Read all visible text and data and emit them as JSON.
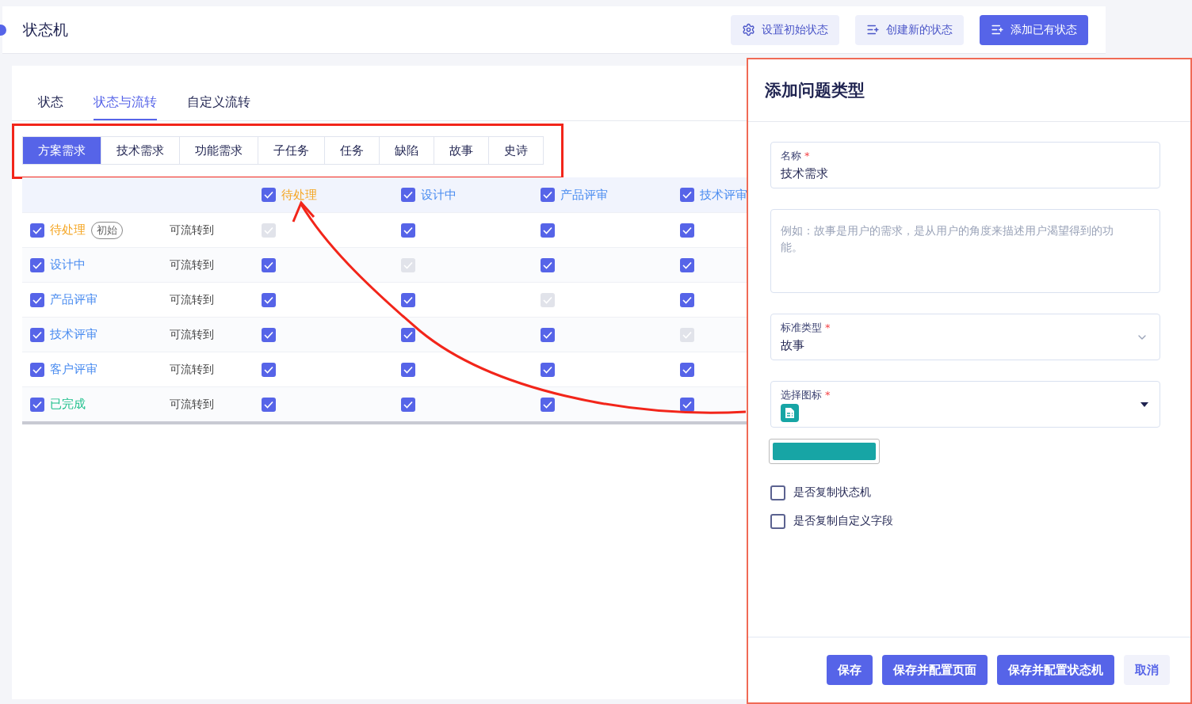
{
  "header": {
    "title": "状态机",
    "actions": [
      {
        "label": "设置初始状态",
        "kind": "settings",
        "primary": false
      },
      {
        "label": "创建新的状态",
        "kind": "add-list",
        "primary": false
      },
      {
        "label": "添加已有状态",
        "kind": "add-list",
        "primary": true
      }
    ]
  },
  "tabs": [
    {
      "label": "状态",
      "selected": false
    },
    {
      "label": "状态与流转",
      "selected": true
    },
    {
      "label": "自定义流转",
      "selected": false
    }
  ],
  "issue_types": [
    {
      "label": "方案需求",
      "selected": true
    },
    {
      "label": "技术需求",
      "selected": false
    },
    {
      "label": "功能需求",
      "selected": false
    },
    {
      "label": "子任务",
      "selected": false
    },
    {
      "label": "任务",
      "selected": false
    },
    {
      "label": "缺陷",
      "selected": false
    },
    {
      "label": "故事",
      "selected": false
    },
    {
      "label": "史诗",
      "selected": false
    }
  ],
  "matrix": {
    "columns": [
      {
        "label": "待处理",
        "color": "#f5a623",
        "checked": true
      },
      {
        "label": "设计中",
        "color": "#4a8cf0",
        "checked": true
      },
      {
        "label": "产品评审",
        "color": "#4a8cf0",
        "checked": true
      },
      {
        "label": "技术评审",
        "color": "#4a8cf0",
        "checked": true
      }
    ],
    "rows": [
      {
        "label": "待处理",
        "color": "#f5a623",
        "checked": true,
        "badge": "初始",
        "transition": "可流转到",
        "cells": [
          {
            "checked": true,
            "disabled": true
          },
          {
            "checked": true,
            "disabled": false
          },
          {
            "checked": true,
            "disabled": false
          },
          {
            "checked": true,
            "disabled": false
          }
        ]
      },
      {
        "label": "设计中",
        "color": "#4a8cf0",
        "checked": true,
        "transition": "可流转到",
        "cells": [
          {
            "checked": true,
            "disabled": false
          },
          {
            "checked": true,
            "disabled": true
          },
          {
            "checked": true,
            "disabled": false
          },
          {
            "checked": true,
            "disabled": false
          }
        ]
      },
      {
        "label": "产品评审",
        "color": "#4a8cf0",
        "checked": true,
        "transition": "可流转到",
        "cells": [
          {
            "checked": true,
            "disabled": false
          },
          {
            "checked": true,
            "disabled": false
          },
          {
            "checked": true,
            "disabled": true
          },
          {
            "checked": true,
            "disabled": false
          }
        ]
      },
      {
        "label": "技术评审",
        "color": "#4a8cf0",
        "checked": true,
        "transition": "可流转到",
        "cells": [
          {
            "checked": true,
            "disabled": false
          },
          {
            "checked": true,
            "disabled": false
          },
          {
            "checked": true,
            "disabled": false
          },
          {
            "checked": true,
            "disabled": true
          }
        ]
      },
      {
        "label": "客户评审",
        "color": "#4a8cf0",
        "checked": true,
        "transition": "可流转到",
        "cells": [
          {
            "checked": true,
            "disabled": false
          },
          {
            "checked": true,
            "disabled": false
          },
          {
            "checked": true,
            "disabled": false
          },
          {
            "checked": true,
            "disabled": false
          }
        ]
      },
      {
        "label": "已完成",
        "color": "#1bbf8a",
        "checked": true,
        "transition": "可流转到",
        "cells": [
          {
            "checked": true,
            "disabled": false
          },
          {
            "checked": true,
            "disabled": false
          },
          {
            "checked": true,
            "disabled": false
          },
          {
            "checked": true,
            "disabled": false
          }
        ]
      }
    ]
  },
  "drawer": {
    "title": "添加问题类型",
    "name_field": {
      "label": "名称",
      "required_mark": "*",
      "value": "技术需求"
    },
    "description": {
      "placeholder": "例如：故事是用户的需求，是从用户的角度来描述用户渴望得到的功能。"
    },
    "standard_type": {
      "label": "标准类型",
      "required_mark": "*",
      "value": "故事"
    },
    "icon_field": {
      "label": "选择图标",
      "required_mark": "*"
    },
    "swatch": {
      "color": "#17a5a5"
    },
    "options": [
      {
        "label": "是否复制状态机",
        "checked": false
      },
      {
        "label": "是否复制自定义字段",
        "checked": false
      }
    ],
    "buttons": [
      {
        "label": "保存",
        "primary": true
      },
      {
        "label": "保存并配置页面",
        "primary": true
      },
      {
        "label": "保存并配置状态机",
        "primary": true
      },
      {
        "label": "取消",
        "primary": false
      }
    ]
  }
}
